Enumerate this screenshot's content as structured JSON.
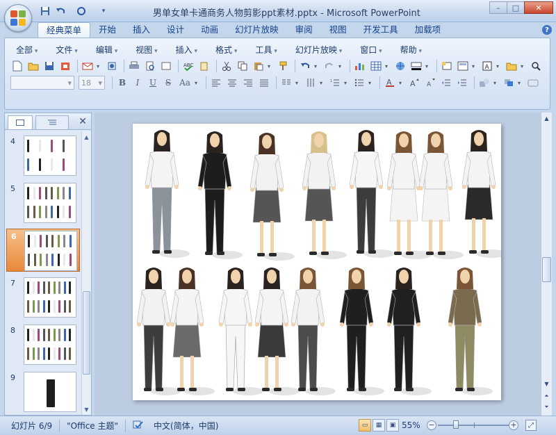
{
  "window": {
    "title": "男单女单卡通商务人物剪影ppt素材.pptx - Microsoft PowerPoint",
    "min": "–",
    "max": "□",
    "close": "✕"
  },
  "quick_access": [
    "save-icon",
    "undo-icon",
    "redo-icon",
    "customize-icon"
  ],
  "tabs": [
    {
      "label": "经典菜单",
      "active": true
    },
    {
      "label": "开始"
    },
    {
      "label": "插入"
    },
    {
      "label": "设计"
    },
    {
      "label": "动画"
    },
    {
      "label": "幻灯片放映"
    },
    {
      "label": "审阅"
    },
    {
      "label": "视图"
    },
    {
      "label": "开发工具"
    },
    {
      "label": "加载项"
    }
  ],
  "help": "?",
  "menus": [
    "全部",
    "文件",
    "编辑",
    "视图",
    "插入",
    "格式",
    "工具",
    "幻灯片放映",
    "窗口",
    "帮助"
  ],
  "toolbar": {
    "font_size": "18",
    "font_name": "",
    "bold": "B",
    "italic": "I",
    "underline": "U",
    "strike": "S",
    "case": "Aa"
  },
  "slides_pane": {
    "thumbnails": [
      {
        "num": "4"
      },
      {
        "num": "5"
      },
      {
        "num": "6",
        "selected": true
      },
      {
        "num": "7"
      },
      {
        "num": "8"
      },
      {
        "num": "9"
      }
    ]
  },
  "status": {
    "slide": "幻灯片 6/9",
    "theme": "\"Office 主题\"",
    "language": "中文(简体，中国)",
    "zoom": "55%",
    "zoom_level": 0.55
  },
  "colors": {
    "accent": "#e8883a",
    "ribbon": "#dbe7f6",
    "workspace": "#bccde2"
  }
}
